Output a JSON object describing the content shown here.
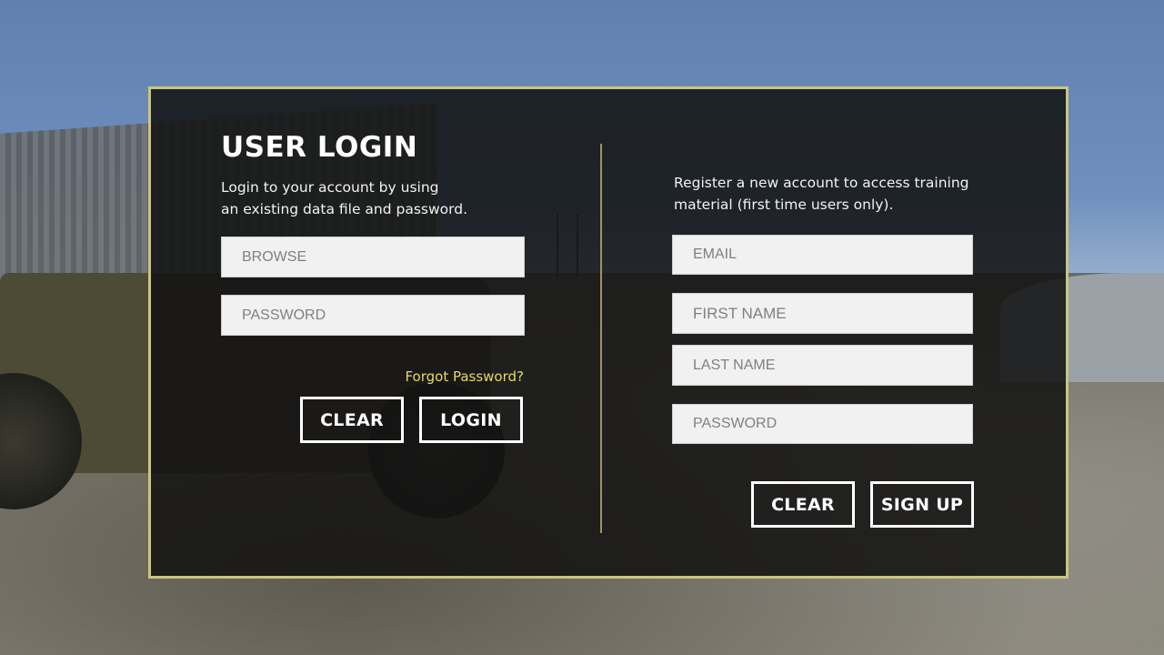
{
  "login": {
    "title": "USER LOGIN",
    "description_line1": "Login to your account by using",
    "description_line2": "an existing data file and password.",
    "browse_placeholder": "BROWSE",
    "password_placeholder": "PASSWORD",
    "forgot_password": "Forgot Password?",
    "clear_label": "CLEAR",
    "login_label": "LOGIN"
  },
  "register": {
    "description_line1": "Register a new account to access training",
    "description_line2": "material (first time users only).",
    "email_placeholder": "EMAIL",
    "first_name_placeholder": "FIRST NAME",
    "last_name_placeholder": "LAST NAME",
    "password_placeholder": "PASSWORD",
    "clear_label": "CLEAR",
    "signup_label": "SIGN UP"
  },
  "colors": {
    "panel_border": "#c9c487",
    "divider": "#9b9460",
    "link": "#e4d96b",
    "field_bg": "#f1f1f1"
  }
}
